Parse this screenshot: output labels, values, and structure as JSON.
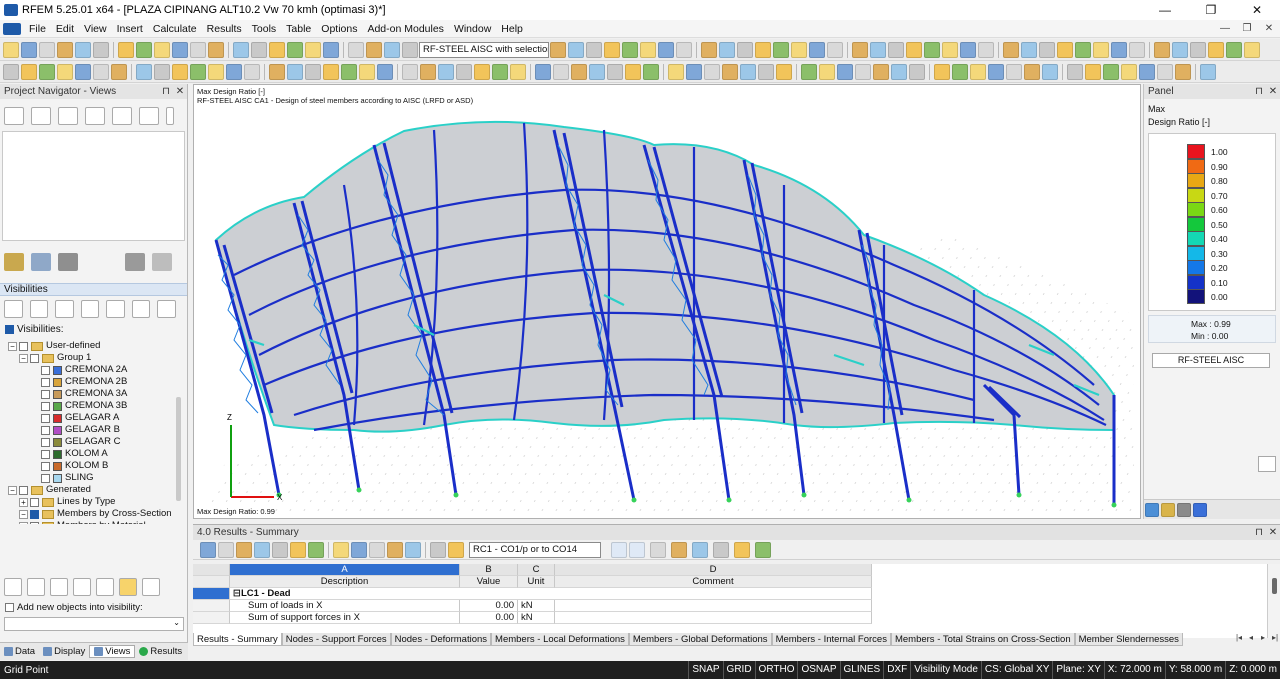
{
  "window": {
    "title": "RFEM 5.25.01 x64 - [PLAZA CIPINANG ALT10.2 Vw 70 kmh (optimasi 3)*]",
    "minimize": "—",
    "maximize": "❐",
    "close": "✕"
  },
  "menu": [
    "File",
    "Edit",
    "View",
    "Insert",
    "Calculate",
    "Results",
    "Tools",
    "Table",
    "Options",
    "Add-on Modules",
    "Window",
    "Help"
  ],
  "menu_mdi": [
    "—",
    "❐",
    "✕"
  ],
  "toolbar": {
    "module_combo": "RF-STEEL AISC with selection -"
  },
  "navigator": {
    "title": "Project Navigator - Views",
    "visibilities_title": "Visibilities",
    "visibilities_label": "Visibilities:",
    "tree": [
      {
        "level": 0,
        "label": "User-defined",
        "type": "folder"
      },
      {
        "level": 1,
        "label": "Group 1",
        "type": "folder"
      },
      {
        "level": 2,
        "label": "CREMONA 2A",
        "color": "#3a6fd8"
      },
      {
        "level": 2,
        "label": "CREMONA 2B",
        "color": "#d8a43a"
      },
      {
        "level": 2,
        "label": "CREMONA 3A",
        "color": "#c79a5a"
      },
      {
        "level": 2,
        "label": "CREMONA 3B",
        "color": "#5aa84a"
      },
      {
        "level": 2,
        "label": "GELAGAR A",
        "color": "#d82c2c"
      },
      {
        "level": 2,
        "label": "GELAGAR B",
        "color": "#b04ec4"
      },
      {
        "level": 2,
        "label": "GELAGAR C",
        "color": "#8a8a3a"
      },
      {
        "level": 2,
        "label": "KOLOM A",
        "color": "#2d6b2d"
      },
      {
        "level": 2,
        "label": "KOLOM B",
        "color": "#c96a2a"
      },
      {
        "level": 2,
        "label": "SLING",
        "color": "#a8d8f0"
      },
      {
        "level": 0,
        "label": "Generated",
        "type": "folder"
      },
      {
        "level": 1,
        "label": "Lines by Type",
        "type": "folder"
      },
      {
        "level": 1,
        "label": "Members by Cross-Section",
        "type": "folder",
        "checked": true
      },
      {
        "level": 1,
        "label": "Members by Material",
        "type": "folder"
      }
    ],
    "add_new_label": "Add new objects into visibility:",
    "tabs": [
      "Data",
      "Display",
      "Views",
      "Results"
    ]
  },
  "viewport": {
    "header_line1": "Max Design Ratio [-]",
    "header_line2": "RF-STEEL AISC CA1 - Design of steel members according to AISC (LRFD or ASD)",
    "footer": "Max Design Ratio: 0.99",
    "axis_x": "X",
    "axis_z": "Z"
  },
  "panel": {
    "title": "Panel",
    "label_max": "Max",
    "label_ratio": "Design Ratio [-]",
    "legend": [
      {
        "value": "1.00",
        "color": "#e8141e"
      },
      {
        "value": "0.90",
        "color": "#f06a14"
      },
      {
        "value": "0.80",
        "color": "#e8a814"
      },
      {
        "value": "0.70",
        "color": "#c8d814"
      },
      {
        "value": "0.60",
        "color": "#7ad814"
      },
      {
        "value": "0.50",
        "color": "#14c83c"
      },
      {
        "value": "0.40",
        "color": "#14d8b4"
      },
      {
        "value": "0.30",
        "color": "#14b8e8"
      },
      {
        "value": "0.20",
        "color": "#1478e8"
      },
      {
        "value": "0.10",
        "color": "#1432c8"
      },
      {
        "value": "0.00",
        "color": "#12127a"
      }
    ],
    "max_label": "Max  :  0.99",
    "min_label": "Min   :  0.00",
    "module_button": "RF-STEEL AISC"
  },
  "results": {
    "title": "4.0 Results - Summary",
    "case_combo": "RC1 - CO1/p or to CO14",
    "columns": [
      {
        "letter": "A",
        "name": "Description"
      },
      {
        "letter": "B",
        "name": "Value"
      },
      {
        "letter": "C",
        "name": "Unit"
      },
      {
        "letter": "D",
        "name": "Comment"
      }
    ],
    "group_row": "LC1 - Dead",
    "rows": [
      {
        "desc": "Sum of loads in X",
        "value": "0.00",
        "unit": "kN"
      },
      {
        "desc": "Sum of support forces in X",
        "value": "0.00",
        "unit": "kN"
      }
    ],
    "tabs": [
      "Results - Summary",
      "Nodes - Support Forces",
      "Nodes - Deformations",
      "Members - Local Deformations",
      "Members - Global Deformations",
      "Members - Internal Forces",
      "Members - Total Strains on Cross-Section",
      "Member Slendernesses"
    ]
  },
  "status": {
    "left": "Grid Point",
    "toggles": [
      "SNAP",
      "GRID",
      "ORTHO",
      "OSNAP",
      "GLINES",
      "DXF"
    ],
    "visibility_mode": "Visibility Mode",
    "cs": "CS: Global XY",
    "plane": "Plane: XY",
    "x": "X:  72.000 m",
    "y": "Y:  58.000 m",
    "z": "Z:  0.000 m"
  }
}
